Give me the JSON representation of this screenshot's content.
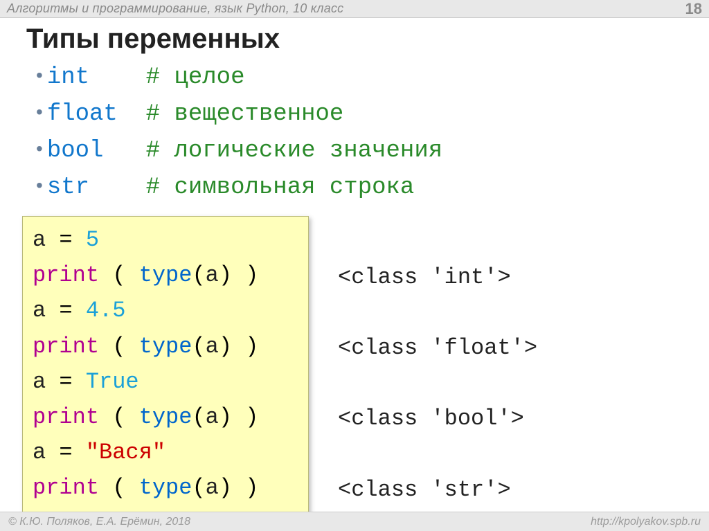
{
  "header": {
    "course": "Алгоритмы и программирование, язык Python, 10 класс",
    "slide_no": "18"
  },
  "title": "Типы переменных",
  "types": [
    {
      "name": "int",
      "pad": "    ",
      "comment": "# целое"
    },
    {
      "name": "float",
      "pad": "  ",
      "comment": "# вещественное"
    },
    {
      "name": "bool",
      "pad": "   ",
      "comment": "# логические значения"
    },
    {
      "name": "str",
      "pad": "    ",
      "comment": "# символьная строка"
    }
  ],
  "code": {
    "var": "a",
    "eq": " = ",
    "print": "print",
    "type": "type",
    "open": " ( ",
    "open2": "(",
    "close": ") ",
    "close2": ")",
    "assigns": [
      {
        "value": "5",
        "cls": "lit-num"
      },
      {
        "value": "4.5",
        "cls": "lit-num"
      },
      {
        "value": "True",
        "cls": "lit-true"
      },
      {
        "value": "\"Вася\"",
        "cls": "lit-str"
      }
    ]
  },
  "outputs": [
    "<class 'int'>",
    "<class 'float'>",
    "<class 'bool'>",
    "<class 'str'>"
  ],
  "footer": {
    "left": "© К.Ю. Поляков, Е.А. Ерёмин, 2018",
    "right": "http://kpolyakov.spb.ru"
  }
}
